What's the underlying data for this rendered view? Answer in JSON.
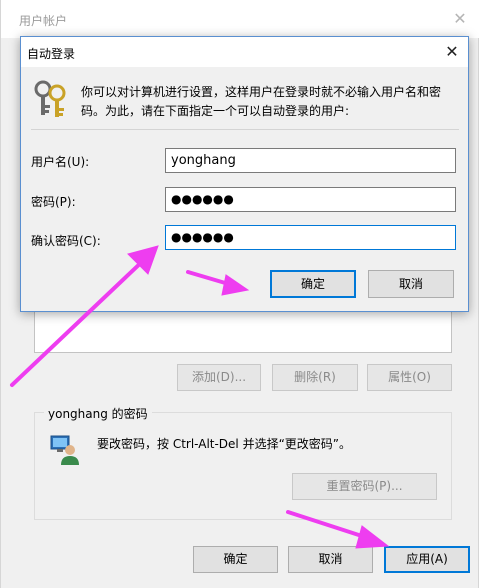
{
  "background_window": {
    "title": "用户帐户",
    "close_glyph": "✕",
    "buttons": {
      "add": "添加(D)...",
      "remove": "删除(R)",
      "properties": "属性(O)"
    },
    "password_group": {
      "title": "yonghang 的密码",
      "message": "要改密码，按 Ctrl-Alt-Del 并选择“更改密码”。",
      "reset_button": "重置密码(P)...",
      "icon": "user-computer-icon"
    },
    "footer": {
      "ok": "确定",
      "cancel": "取消",
      "apply": "应用(A)"
    }
  },
  "dialog": {
    "title": "自动登录",
    "close_glyph": "✕",
    "icon": "keys-icon",
    "description_line1": "你可以对计算机进行设置，这样用户在登录时就不必输入用户名和密",
    "description_line2": "码。为此，请在下面指定一个可以自动登录的用户:",
    "fields": {
      "username_label": "用户名(U):",
      "username_value": "yonghang",
      "password_label": "密码(P):",
      "password_value": "●●●●●●",
      "confirm_label": "确认密码(C):",
      "confirm_value": "●●●●●●"
    },
    "ok": "确定",
    "cancel": "取消"
  },
  "colors": {
    "annotation_arrow": "#ee3df0",
    "focus_border": "#0078d7"
  }
}
